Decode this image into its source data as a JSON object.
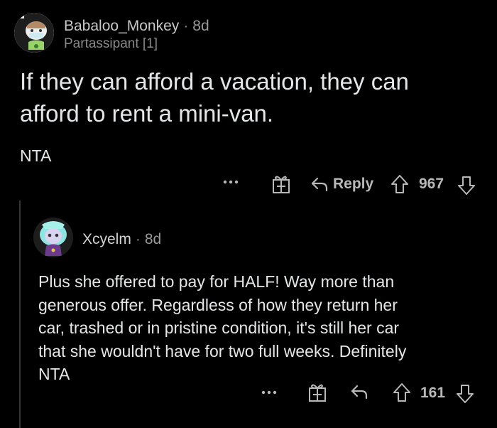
{
  "colors": {
    "background": "#000000",
    "text": "#e4e6e8",
    "muted": "#8a8a8a",
    "thread_line": "#343536"
  },
  "comment": {
    "author": "Babaloo_Monkey",
    "separator": "·",
    "age": "8d",
    "flair": "Partassipant [1]",
    "avatar_icon": "snoo-avatar-icon",
    "body_line1": "If they can afford a vacation, they can",
    "body_line2": "afford to rent a mini-van.",
    "body_line3": "NTA",
    "actions": {
      "more_icon": "ellipsis-icon",
      "award_icon": "gift-icon",
      "reply_label": "Reply",
      "upvote_icon": "arrow-up-icon",
      "score": "967",
      "downvote_icon": "arrow-down-icon"
    }
  },
  "reply": {
    "author": "Xcyelm",
    "separator": "·",
    "age": "8d",
    "avatar_icon": "snoo-avatar-icon",
    "body": "Plus she offered to pay for HALF! Way more than\ngenerous offer. Regardless of how they return her\ncar, trashed or in pristine condition, it's still her car\nthat she wouldn't have for two full weeks. Definitely\nNTA",
    "actions": {
      "more_icon": "ellipsis-icon",
      "award_icon": "gift-icon",
      "reply_icon": "reply-arrow-icon",
      "upvote_icon": "arrow-up-icon",
      "score": "161",
      "downvote_icon": "arrow-down-icon"
    }
  }
}
